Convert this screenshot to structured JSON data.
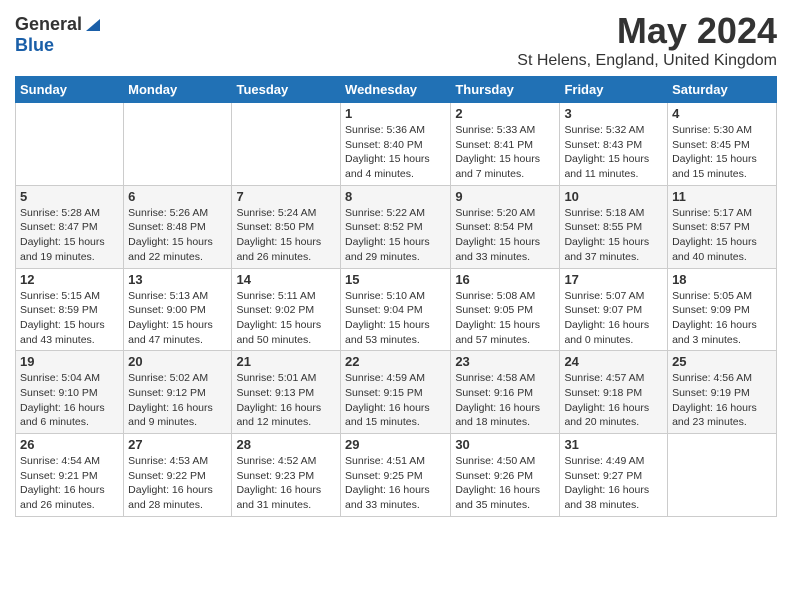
{
  "header": {
    "logo_general": "General",
    "logo_blue": "Blue",
    "month": "May 2024",
    "location": "St Helens, England, United Kingdom"
  },
  "weekdays": [
    "Sunday",
    "Monday",
    "Tuesday",
    "Wednesday",
    "Thursday",
    "Friday",
    "Saturday"
  ],
  "weeks": [
    [
      {
        "day": "",
        "info": ""
      },
      {
        "day": "",
        "info": ""
      },
      {
        "day": "",
        "info": ""
      },
      {
        "day": "1",
        "info": "Sunrise: 5:36 AM\nSunset: 8:40 PM\nDaylight: 15 hours\nand 4 minutes."
      },
      {
        "day": "2",
        "info": "Sunrise: 5:33 AM\nSunset: 8:41 PM\nDaylight: 15 hours\nand 7 minutes."
      },
      {
        "day": "3",
        "info": "Sunrise: 5:32 AM\nSunset: 8:43 PM\nDaylight: 15 hours\nand 11 minutes."
      },
      {
        "day": "4",
        "info": "Sunrise: 5:30 AM\nSunset: 8:45 PM\nDaylight: 15 hours\nand 15 minutes."
      }
    ],
    [
      {
        "day": "5",
        "info": "Sunrise: 5:28 AM\nSunset: 8:47 PM\nDaylight: 15 hours\nand 19 minutes."
      },
      {
        "day": "6",
        "info": "Sunrise: 5:26 AM\nSunset: 8:48 PM\nDaylight: 15 hours\nand 22 minutes."
      },
      {
        "day": "7",
        "info": "Sunrise: 5:24 AM\nSunset: 8:50 PM\nDaylight: 15 hours\nand 26 minutes."
      },
      {
        "day": "8",
        "info": "Sunrise: 5:22 AM\nSunset: 8:52 PM\nDaylight: 15 hours\nand 29 minutes."
      },
      {
        "day": "9",
        "info": "Sunrise: 5:20 AM\nSunset: 8:54 PM\nDaylight: 15 hours\nand 33 minutes."
      },
      {
        "day": "10",
        "info": "Sunrise: 5:18 AM\nSunset: 8:55 PM\nDaylight: 15 hours\nand 37 minutes."
      },
      {
        "day": "11",
        "info": "Sunrise: 5:17 AM\nSunset: 8:57 PM\nDaylight: 15 hours\nand 40 minutes."
      }
    ],
    [
      {
        "day": "12",
        "info": "Sunrise: 5:15 AM\nSunset: 8:59 PM\nDaylight: 15 hours\nand 43 minutes."
      },
      {
        "day": "13",
        "info": "Sunrise: 5:13 AM\nSunset: 9:00 PM\nDaylight: 15 hours\nand 47 minutes."
      },
      {
        "day": "14",
        "info": "Sunrise: 5:11 AM\nSunset: 9:02 PM\nDaylight: 15 hours\nand 50 minutes."
      },
      {
        "day": "15",
        "info": "Sunrise: 5:10 AM\nSunset: 9:04 PM\nDaylight: 15 hours\nand 53 minutes."
      },
      {
        "day": "16",
        "info": "Sunrise: 5:08 AM\nSunset: 9:05 PM\nDaylight: 15 hours\nand 57 minutes."
      },
      {
        "day": "17",
        "info": "Sunrise: 5:07 AM\nSunset: 9:07 PM\nDaylight: 16 hours\nand 0 minutes."
      },
      {
        "day": "18",
        "info": "Sunrise: 5:05 AM\nSunset: 9:09 PM\nDaylight: 16 hours\nand 3 minutes."
      }
    ],
    [
      {
        "day": "19",
        "info": "Sunrise: 5:04 AM\nSunset: 9:10 PM\nDaylight: 16 hours\nand 6 minutes."
      },
      {
        "day": "20",
        "info": "Sunrise: 5:02 AM\nSunset: 9:12 PM\nDaylight: 16 hours\nand 9 minutes."
      },
      {
        "day": "21",
        "info": "Sunrise: 5:01 AM\nSunset: 9:13 PM\nDaylight: 16 hours\nand 12 minutes."
      },
      {
        "day": "22",
        "info": "Sunrise: 4:59 AM\nSunset: 9:15 PM\nDaylight: 16 hours\nand 15 minutes."
      },
      {
        "day": "23",
        "info": "Sunrise: 4:58 AM\nSunset: 9:16 PM\nDaylight: 16 hours\nand 18 minutes."
      },
      {
        "day": "24",
        "info": "Sunrise: 4:57 AM\nSunset: 9:18 PM\nDaylight: 16 hours\nand 20 minutes."
      },
      {
        "day": "25",
        "info": "Sunrise: 4:56 AM\nSunset: 9:19 PM\nDaylight: 16 hours\nand 23 minutes."
      }
    ],
    [
      {
        "day": "26",
        "info": "Sunrise: 4:54 AM\nSunset: 9:21 PM\nDaylight: 16 hours\nand 26 minutes."
      },
      {
        "day": "27",
        "info": "Sunrise: 4:53 AM\nSunset: 9:22 PM\nDaylight: 16 hours\nand 28 minutes."
      },
      {
        "day": "28",
        "info": "Sunrise: 4:52 AM\nSunset: 9:23 PM\nDaylight: 16 hours\nand 31 minutes."
      },
      {
        "day": "29",
        "info": "Sunrise: 4:51 AM\nSunset: 9:25 PM\nDaylight: 16 hours\nand 33 minutes."
      },
      {
        "day": "30",
        "info": "Sunrise: 4:50 AM\nSunset: 9:26 PM\nDaylight: 16 hours\nand 35 minutes."
      },
      {
        "day": "31",
        "info": "Sunrise: 4:49 AM\nSunset: 9:27 PM\nDaylight: 16 hours\nand 38 minutes."
      },
      {
        "day": "",
        "info": ""
      }
    ]
  ]
}
